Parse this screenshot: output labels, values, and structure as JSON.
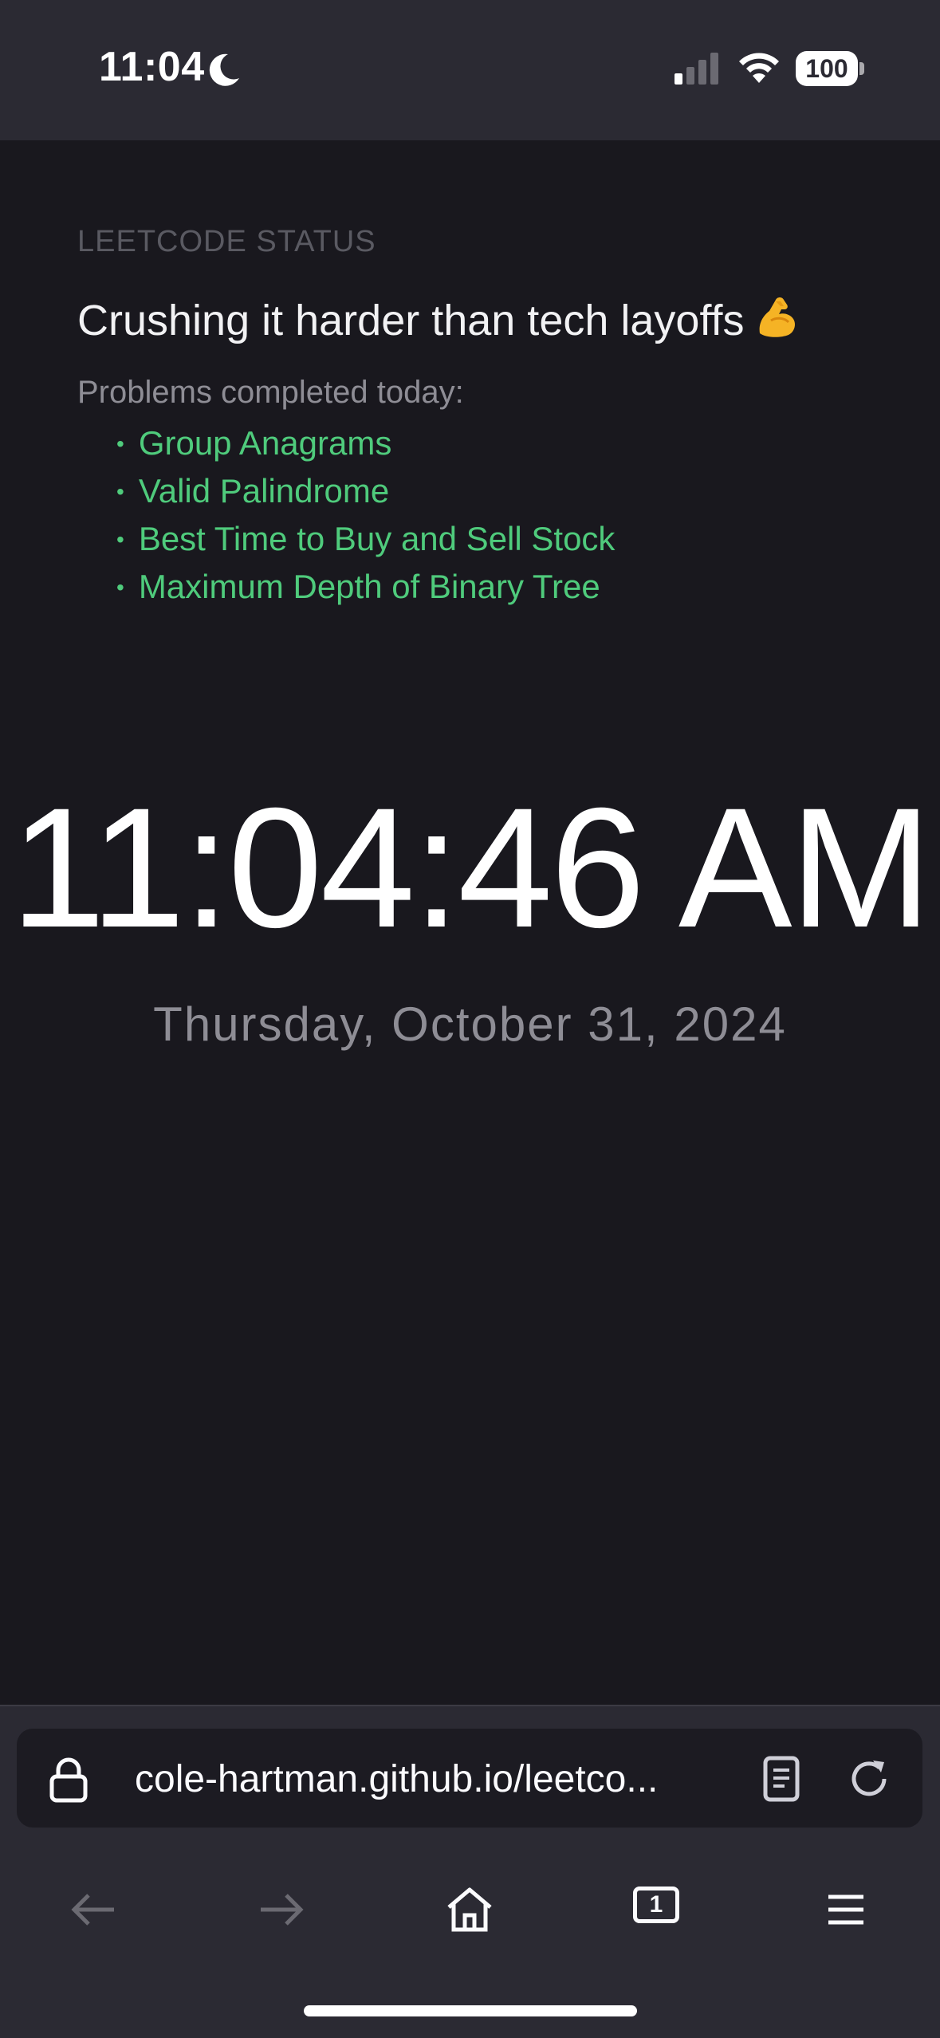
{
  "status_bar": {
    "time": "11:04",
    "battery": "100"
  },
  "page": {
    "eyebrow": "LEETCODE STATUS",
    "headline": "Crushing it harder than tech layoffs",
    "problems_label": "Problems completed today:",
    "problems": [
      "Group Anagrams",
      "Valid Palindrome",
      "Best Time to Buy and Sell Stock",
      "Maximum Depth of Binary Tree"
    ],
    "clock": "11:04:46 AM",
    "date": "Thursday, October 31, 2024"
  },
  "browser": {
    "url": "cole-hartman.github.io/leetco...",
    "tab_count": "1"
  },
  "icons": {
    "status": [
      "moon-icon",
      "signal-icon",
      "wifi-icon",
      "battery-icon"
    ],
    "url_bar": [
      "lock-icon",
      "reader-view-icon",
      "reload-icon"
    ],
    "toolbar": [
      "back-arrow-icon",
      "forward-arrow-icon",
      "home-icon",
      "tabs-icon",
      "menu-icon"
    ]
  },
  "colors": {
    "page_background": "#19181e",
    "chrome_background": "#2b2a33",
    "problem_green": "#4fcb7c",
    "muted_text": "#8e8d95"
  }
}
